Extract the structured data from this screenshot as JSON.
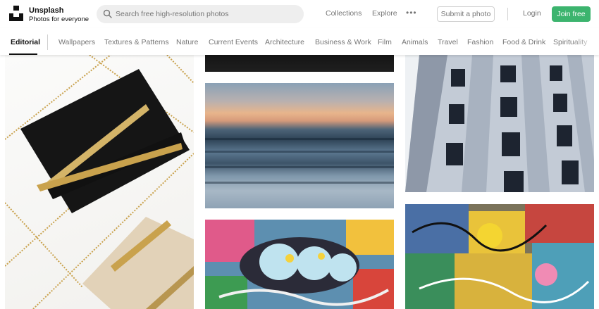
{
  "header": {
    "brand_name": "Unsplash",
    "brand_tagline": "Photos for everyone",
    "search_placeholder": "Search free high-resolution photos",
    "nav": [
      "Collections",
      "Explore"
    ],
    "submit_label": "Submit a photo",
    "login_label": "Login",
    "join_label": "Join free"
  },
  "categories": {
    "active": "Editorial",
    "items": [
      "Wallpapers",
      "Textures & Patterns",
      "Nature",
      "Current Events",
      "Architecture",
      "Business & Work",
      "Film",
      "Animals",
      "Travel",
      "Fashion",
      "Food & Drink",
      "Spirituality"
    ]
  },
  "colors": {
    "accent_green": "#3cb46e",
    "text_muted": "#767676",
    "border": "#d1d1d1"
  },
  "photos": [
    {
      "name": "clutch-handbags-photo",
      "subject": "black and gold glitter clutch bags"
    },
    {
      "name": "dark-strip-photo",
      "subject": "dark"
    },
    {
      "name": "ocean-sunset-photo",
      "subject": "long exposure sea at sunset"
    },
    {
      "name": "graffiti-photo-1",
      "subject": "graffiti wall"
    },
    {
      "name": "building-facade-photo",
      "subject": "modern building facade"
    },
    {
      "name": "graffiti-photo-2",
      "subject": "graffiti wall"
    }
  ]
}
